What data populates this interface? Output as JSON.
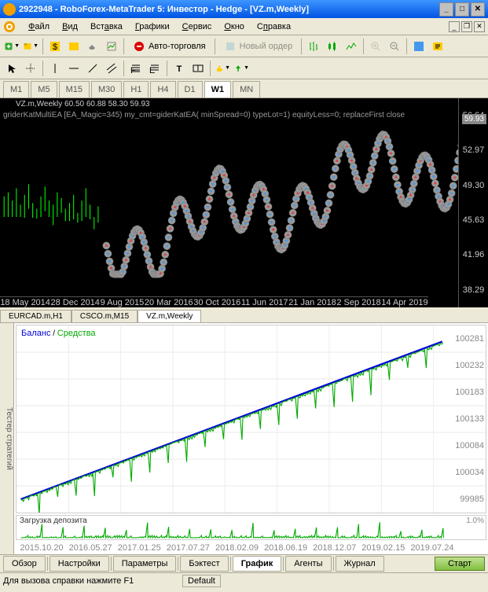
{
  "window": {
    "title": "2922948 - RoboForex-MetaTrader 5: Инвестор - Hedge - [VZ.m,Weekly]"
  },
  "menu": {
    "file": "Файл",
    "view": "Вид",
    "insert": "Вставка",
    "charts": "Графики",
    "tools": "Сервис",
    "window": "Окно",
    "help": "Справка"
  },
  "toolbar": {
    "autotrading": "Авто-торговля",
    "neworder": "Новый ордер"
  },
  "timeframes": {
    "m1": "M1",
    "m5": "M5",
    "m15": "M15",
    "m30": "M30",
    "h1": "H1",
    "h4": "H4",
    "d1": "D1",
    "w1": "W1",
    "mn": "MN"
  },
  "chart": {
    "symbol_info": "VZ.m,Weekly  60.50 60.88 58.30 59.93",
    "ea_info": "griderKatMultiEA [EA_Magic=345) my_cmt=giderKatEA( minSpread=0) typeLot=1) equityLess=0; replaceFirst           close",
    "price_tag": "59.93",
    "yticks": [
      "56.64",
      "52.97",
      "49.30",
      "45.63",
      "41.96",
      "38.29"
    ],
    "xticks": [
      "18 May 2014",
      "28 Dec 2014",
      "9 Aug 2015",
      "20 Mar 2016",
      "30 Oct 2016",
      "11 Jun 2017",
      "21 Jan 2018",
      "2 Sep 2018",
      "14 Apr 2019"
    ]
  },
  "chart_tabs": {
    "items": [
      {
        "label": "EURCAD.m,H1"
      },
      {
        "label": "CSCO.m,M15"
      },
      {
        "label": "VZ.m,Weekly"
      }
    ]
  },
  "tester": {
    "side_label": "Тестер стратегий",
    "legend_balance": "Баланс",
    "legend_equity": "Средства",
    "equity_yticks": [
      "100281",
      "100232",
      "100183",
      "100133",
      "100084",
      "100034",
      "99985"
    ],
    "load_label": "Загрузка депозита",
    "load_value": "1.0%",
    "xticks": [
      "2015.10.20",
      "2016.05.27",
      "2017.01.25",
      "2017.07.27",
      "2018.02.09",
      "2018.06.19",
      "2018.12.07",
      "2019.02.15",
      "2019.07.24"
    ]
  },
  "tester_tabs": {
    "items": [
      "Обзор",
      "Настройки",
      "Параметры",
      "Бэктест",
      "График",
      "Агенты",
      "Журнал"
    ],
    "start": "Старт"
  },
  "status": {
    "help": "Для вызова справки нажмите F1",
    "default": "Default"
  },
  "chart_data": {
    "type": "candlestick-with-markers",
    "symbol": "VZ.m",
    "timeframe": "Weekly",
    "price_range": [
      38.29,
      60.88
    ],
    "time_range": [
      "2014-05-18",
      "2019-07-24"
    ],
    "ohlc_sample": {
      "open": 60.5,
      "high": 60.88,
      "low": 58.3,
      "close": 59.93
    },
    "balance_curve": {
      "type": "line",
      "name": "Баланс/Средства",
      "x_range": [
        "2015-10-20",
        "2019-07-24"
      ],
      "y_range": [
        99985,
        100281
      ],
      "trend": "monotonic-increasing"
    },
    "deposit_load": {
      "max_pct": 1.0
    }
  }
}
